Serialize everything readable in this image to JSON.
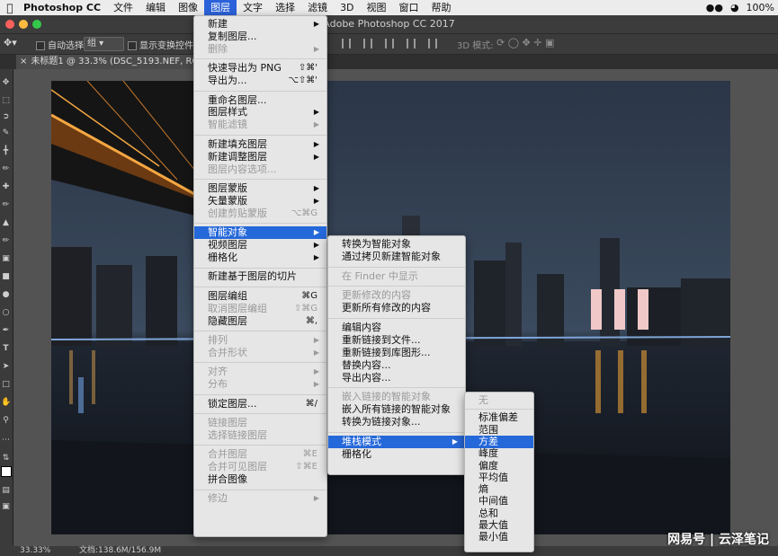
{
  "menubar": {
    "apple_icon": "apple-logo",
    "app_name": "Photoshop CC",
    "items": [
      "文件",
      "编辑",
      "图像",
      "图层",
      "文字",
      "选择",
      "滤镜",
      "3D",
      "视图",
      "窗口",
      "帮助"
    ],
    "active_item": "图层",
    "battery": "100%"
  },
  "window": {
    "title": "Adobe Photoshop CC 2017"
  },
  "options_bar": {
    "auto_select_label": "自动选择:",
    "auto_select_value": "组",
    "show_transform_label": "显示变换控件",
    "mode_3d_label": "3D 模式:"
  },
  "document": {
    "tab_title": "未标题1 @ 33.3% (DSC_5193.NEF, RGB/16",
    "zoom": "33.33%",
    "doc_info": "文档:138.6M/156.9M"
  },
  "layer_menu": [
    {
      "label": "新建",
      "arrow": true
    },
    {
      "label": "复制图层..."
    },
    {
      "label": "删除",
      "disabled": true,
      "arrow": true
    },
    {
      "sep": true
    },
    {
      "label": "快速导出为 PNG",
      "shortcut": "⇧⌘'"
    },
    {
      "label": "导出为...",
      "shortcut": "⌥⇧⌘'"
    },
    {
      "sep": true
    },
    {
      "label": "重命名图层..."
    },
    {
      "label": "图层样式",
      "arrow": true
    },
    {
      "label": "智能滤镜",
      "disabled": true,
      "arrow": true
    },
    {
      "sep": true
    },
    {
      "label": "新建填充图层",
      "arrow": true
    },
    {
      "label": "新建调整图层",
      "arrow": true
    },
    {
      "label": "图层内容选项...",
      "disabled": true
    },
    {
      "sep": true
    },
    {
      "label": "图层蒙版",
      "arrow": true
    },
    {
      "label": "矢量蒙版",
      "arrow": true
    },
    {
      "label": "创建剪贴蒙版",
      "disabled": true,
      "shortcut": "⌥⌘G"
    },
    {
      "sep": true
    },
    {
      "label": "智能对象",
      "arrow": true,
      "highlighted": true
    },
    {
      "label": "视频图层",
      "arrow": true
    },
    {
      "label": "栅格化",
      "arrow": true
    },
    {
      "sep": true
    },
    {
      "label": "新建基于图层的切片"
    },
    {
      "sep": true
    },
    {
      "label": "图层编组",
      "shortcut": "⌘G"
    },
    {
      "label": "取消图层编组",
      "disabled": true,
      "shortcut": "⇧⌘G"
    },
    {
      "label": "隐藏图层",
      "shortcut": "⌘,"
    },
    {
      "sep": true
    },
    {
      "label": "排列",
      "disabled": true,
      "arrow": true
    },
    {
      "label": "合并形状",
      "disabled": true,
      "arrow": true
    },
    {
      "sep": true
    },
    {
      "label": "对齐",
      "disabled": true,
      "arrow": true
    },
    {
      "label": "分布",
      "disabled": true,
      "arrow": true
    },
    {
      "sep": true
    },
    {
      "label": "锁定图层...",
      "shortcut": "⌘/"
    },
    {
      "sep": true
    },
    {
      "label": "链接图层",
      "disabled": true
    },
    {
      "label": "选择链接图层",
      "disabled": true
    },
    {
      "sep": true
    },
    {
      "label": "合并图层",
      "disabled": true,
      "shortcut": "⌘E"
    },
    {
      "label": "合并可见图层",
      "disabled": true,
      "shortcut": "⇧⌘E"
    },
    {
      "label": "拼合图像"
    },
    {
      "sep": true
    },
    {
      "label": "修边",
      "disabled": true,
      "arrow": true
    }
  ],
  "smart_object_menu": [
    {
      "label": "转换为智能对象"
    },
    {
      "label": "通过拷贝新建智能对象"
    },
    {
      "sep": true
    },
    {
      "label": "在 Finder 中显示",
      "disabled": true
    },
    {
      "sep": true
    },
    {
      "label": "更新修改的内容",
      "disabled": true
    },
    {
      "label": "更新所有修改的内容"
    },
    {
      "sep": true
    },
    {
      "label": "编辑内容"
    },
    {
      "label": "重新链接到文件..."
    },
    {
      "label": "重新链接到库图形..."
    },
    {
      "label": "替换内容..."
    },
    {
      "label": "导出内容..."
    },
    {
      "sep": true
    },
    {
      "label": "嵌入链接的智能对象",
      "disabled": true
    },
    {
      "label": "嵌入所有链接的智能对象"
    },
    {
      "label": "转换为链接对象..."
    },
    {
      "sep": true
    },
    {
      "label": "堆栈模式",
      "arrow": true,
      "highlighted": true
    },
    {
      "label": "栅格化"
    }
  ],
  "stack_mode_menu": [
    {
      "label": "无",
      "disabled": true
    },
    {
      "sep": true
    },
    {
      "label": "标准偏差"
    },
    {
      "label": "范围"
    },
    {
      "label": "方差",
      "highlighted": true
    },
    {
      "label": "峰度"
    },
    {
      "label": "偏度"
    },
    {
      "label": "平均值"
    },
    {
      "label": "熵"
    },
    {
      "label": "中间值"
    },
    {
      "label": "总和"
    },
    {
      "label": "最大值"
    },
    {
      "label": "最小值"
    }
  ],
  "watermark": "网易号 | 云泽笔记"
}
